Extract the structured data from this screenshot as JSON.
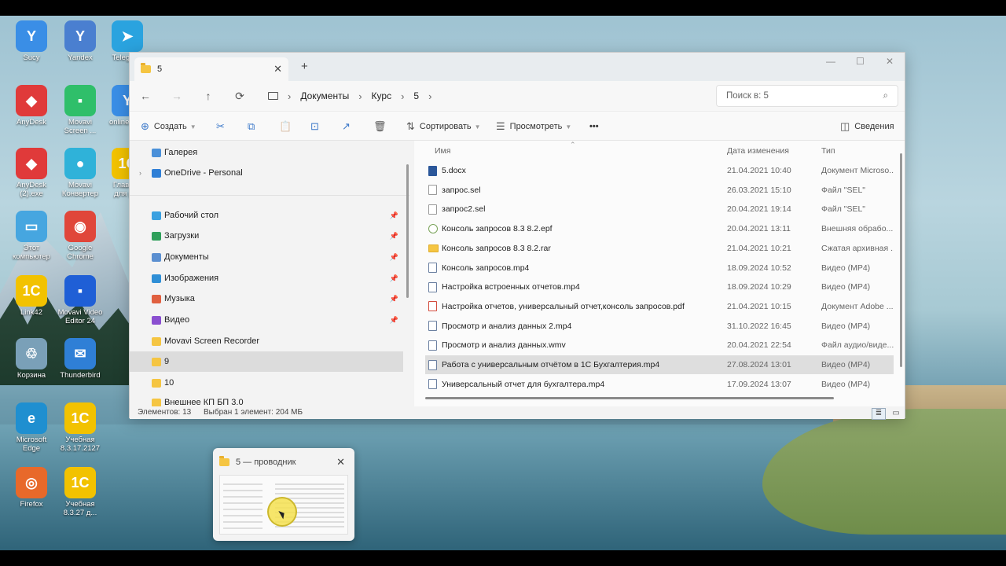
{
  "desktop": {
    "icons": [
      {
        "label": "Sucy",
        "color": "#3a8ee6",
        "glyph": "Y"
      },
      {
        "label": "Yandex",
        "color": "#4a7fd0",
        "glyph": "Y"
      },
      {
        "label": "Telegram",
        "color": "#2aa3df",
        "glyph": "➤"
      },
      {
        "label": "AnyDesk",
        "color": "#e03a3a",
        "glyph": "◆"
      },
      {
        "label": "Movavi\nScreen ...",
        "color": "#2fbf6a",
        "glyph": "▪"
      },
      {
        "label": "onlinestu...",
        "color": "#3a8ee6",
        "glyph": "Y"
      },
      {
        "label": "AnyDesk\n(2).exe",
        "color": "#e03a3a",
        "glyph": "◆"
      },
      {
        "label": "Movavi\nКонвертер",
        "color": "#2fb2d9",
        "glyph": "●"
      },
      {
        "label": "Главное\nдля раз",
        "color": "#f2c200",
        "glyph": "1С"
      },
      {
        "label": "Этот\nкомпьютер",
        "color": "#46a6e0",
        "glyph": "▭"
      },
      {
        "label": "Google\nChrome",
        "color": "#e0463a",
        "glyph": "◉"
      },
      {
        "label": "Link42",
        "color": "#f2c200",
        "glyph": "1С"
      },
      {
        "label": "Movavi Video\nEditor 24",
        "color": "#1f5fd6",
        "glyph": "▪"
      },
      {
        "label": "Корзина",
        "color": "#7aa0b8",
        "glyph": "♲"
      },
      {
        "label": "Thunderbird",
        "color": "#2f7fd6",
        "glyph": "✉"
      },
      {
        "label": "Microsoft\nEdge",
        "color": "#1f8fd0",
        "glyph": "e"
      },
      {
        "label": "Учебная\n8.3.17.2127",
        "color": "#f2c200",
        "glyph": "1С"
      },
      {
        "label": "Firefox",
        "color": "#e8692a",
        "glyph": "◎"
      },
      {
        "label": "Учебная\n8.3.27 д...",
        "color": "#f2c200",
        "glyph": "1С"
      }
    ]
  },
  "window": {
    "tab_title": "5",
    "close_glyph": "✕",
    "newtab_glyph": "+",
    "controls": [
      "—",
      "☐",
      "✕"
    ],
    "nav": {
      "back": "←",
      "forward": "→",
      "up": "↑",
      "refresh": "⟳"
    },
    "breadcrumbs": [
      "Документы",
      "Курс",
      "5"
    ],
    "search_placeholder": "Поиск в: 5",
    "search_icon": "⌕",
    "toolbar": {
      "create": "Создать",
      "sort": "Сортировать",
      "view": "Просмотреть",
      "more": "•••",
      "details": "Сведения",
      "icons": [
        "✂",
        "⧉",
        "📋",
        "⊡",
        "↗",
        "🗑"
      ]
    },
    "sidebar": [
      {
        "label": "Галерея",
        "color": "#4a90d9",
        "pinned": false,
        "expander": ""
      },
      {
        "label": "OneDrive - Personal",
        "color": "#2f7fd6",
        "pinned": false,
        "expander": "›"
      },
      {
        "label": "Рабочий стол",
        "color": "#3aa0e0",
        "pinned": true,
        "expander": ""
      },
      {
        "label": "Загрузки",
        "color": "#2f9f5a",
        "pinned": true,
        "expander": ""
      },
      {
        "label": "Документы",
        "color": "#5b8fd0",
        "pinned": true,
        "expander": ""
      },
      {
        "label": "Изображения",
        "color": "#2f8fd6",
        "pinned": true,
        "expander": ""
      },
      {
        "label": "Музыка",
        "color": "#e06040",
        "pinned": true,
        "expander": ""
      },
      {
        "label": "Видео",
        "color": "#8a4fd0",
        "pinned": true,
        "expander": ""
      },
      {
        "label": "Movavi Screen Recorder",
        "color": "#f5c542",
        "pinned": false,
        "expander": ""
      },
      {
        "label": "9",
        "color": "#f5c542",
        "pinned": false,
        "expander": "",
        "selected": true
      },
      {
        "label": "10",
        "color": "#f5c542",
        "pinned": false,
        "expander": ""
      },
      {
        "label": "Внешнее КП БП 3.0",
        "color": "#f5c542",
        "pinned": false,
        "expander": ""
      }
    ],
    "pin_glyph": "📌",
    "columns": {
      "name": "Имя",
      "date": "Дата изменения",
      "type": "Тип"
    },
    "files": [
      {
        "name": "5.docx",
        "date": "21.04.2021 10:40",
        "type": "Документ Microso...",
        "kind": "word"
      },
      {
        "name": "запрос.sel",
        "date": "26.03.2021 15:10",
        "type": "Файл \"SEL\"",
        "kind": "doc"
      },
      {
        "name": "запрос2.sel",
        "date": "20.04.2021 19:14",
        "type": "Файл \"SEL\"",
        "kind": "doc"
      },
      {
        "name": "Консоль запросов 8.3 8.2.epf",
        "date": "20.04.2021 13:11",
        "type": "Внешняя обрабо...",
        "kind": "epf"
      },
      {
        "name": "Консоль запросов 8.3 8.2.rar",
        "date": "21.04.2021 10:21",
        "type": "Сжатая архивная ...",
        "kind": "rar"
      },
      {
        "name": "Консоль запросов.mp4",
        "date": "18.09.2024 10:52",
        "type": "Видео (MP4)",
        "kind": "vid"
      },
      {
        "name": "Настройка встроенных отчетов.mp4",
        "date": "18.09.2024 10:29",
        "type": "Видео (MP4)",
        "kind": "vid"
      },
      {
        "name": "Настройка отчетов, универсальный отчет,консоль запросов.pdf",
        "date": "21.04.2021 10:15",
        "type": "Документ Adobe ...",
        "kind": "pdf"
      },
      {
        "name": "Просмотр и анализ данных 2.mp4",
        "date": "31.10.2022 16:45",
        "type": "Видео (MP4)",
        "kind": "vid"
      },
      {
        "name": "Просмотр и анализ данных.wmv",
        "date": "20.04.2021 22:54",
        "type": "Файл аудио/виде...",
        "kind": "vid"
      },
      {
        "name": "Работа с универсальным отчётом в 1С Бухгалтерия.mp4",
        "date": "27.08.2024 13:01",
        "type": "Видео (MP4)",
        "kind": "vid",
        "selected": true
      },
      {
        "name": "Универсальный отчет для бухгалтера.mp4",
        "date": "17.09.2024 13:07",
        "type": "Видео (MP4)",
        "kind": "vid"
      }
    ],
    "status": {
      "count": "Элементов: 13",
      "selection": "Выбран 1 элемент: 204 МБ"
    }
  },
  "taskbar_thumb": {
    "title": "5 — проводник",
    "close": "✕"
  }
}
